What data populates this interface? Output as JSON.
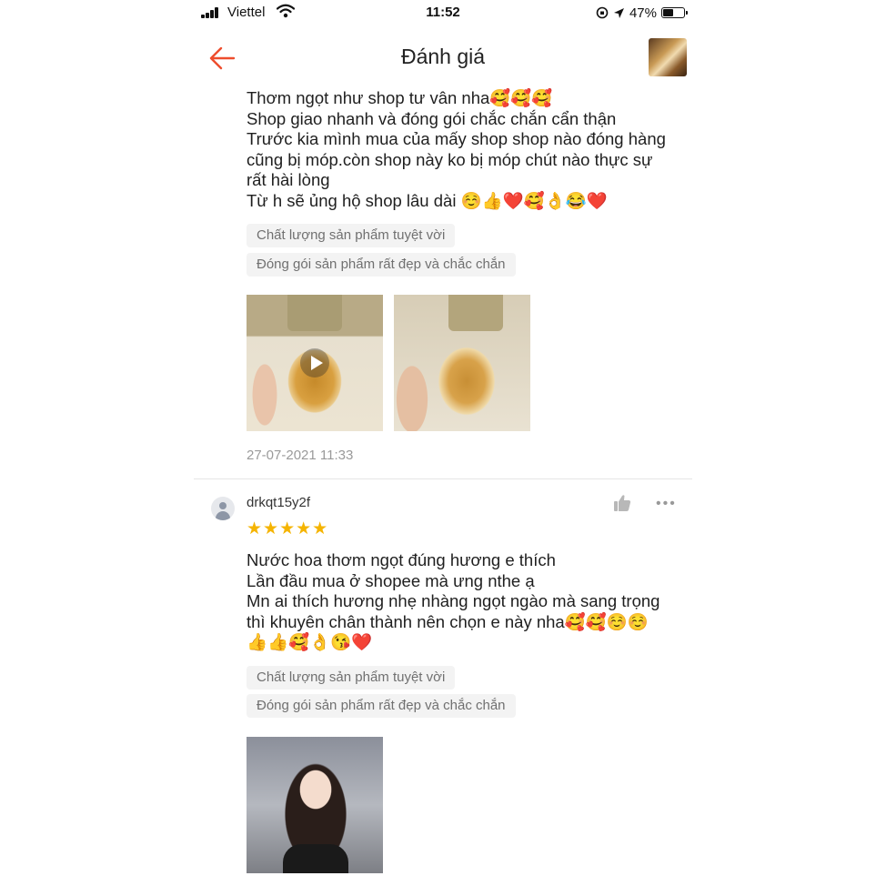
{
  "status_bar": {
    "carrier": "Viettel",
    "time": "11:52",
    "battery": "47%"
  },
  "header": {
    "title": "Đánh giá"
  },
  "review1": {
    "text": "Thơm ngọt như shop tư vân nha🥰🥰🥰\nShop giao nhanh và đóng gói chắc chắn cẩn thận\nTrước kia mình mua của mấy shop shop nào đóng hàng\ncũng bị móp.còn shop này ko bị móp chút nào thực sự\nrất hài lòng\nTừ h sẽ ủng hộ shop lâu dài ☺️👍❤️🥰👌😂❤️",
    "tags": [
      "Chất lượng sản phẩm tuyệt vời",
      "Đóng gói sản phẩm rất đẹp và chắc chắn"
    ],
    "date": "27-07-2021 11:33"
  },
  "review2": {
    "username": "drkqt15y2f",
    "stars": "★★★★★",
    "rating": 5,
    "more": "•••",
    "text": "Nước hoa thơm ngọt đúng hương e thích\nLần đầu mua ở shopee mà ưng nthe ạ\nMn ai thích hương nhẹ nhàng ngọt ngào mà sang trọng\nthì khuyên chân thành nên chọn e này nha🥰🥰☺️☺️\n👍👍🥰👌😘❤️",
    "tags": [
      "Chất lượng sản phẩm tuyệt vời",
      "Đóng gói sản phẩm rất đẹp và chắc chắn"
    ]
  },
  "colors": {
    "accent": "#ee4d2d",
    "star": "#f5b400",
    "tag_bg": "#f3f3f3",
    "muted_text": "#9a9a9a"
  },
  "icons": {
    "back": "arrow-left-icon",
    "play": "play-icon",
    "like": "thumbs-up-icon",
    "more": "more-horizontal-icon"
  }
}
